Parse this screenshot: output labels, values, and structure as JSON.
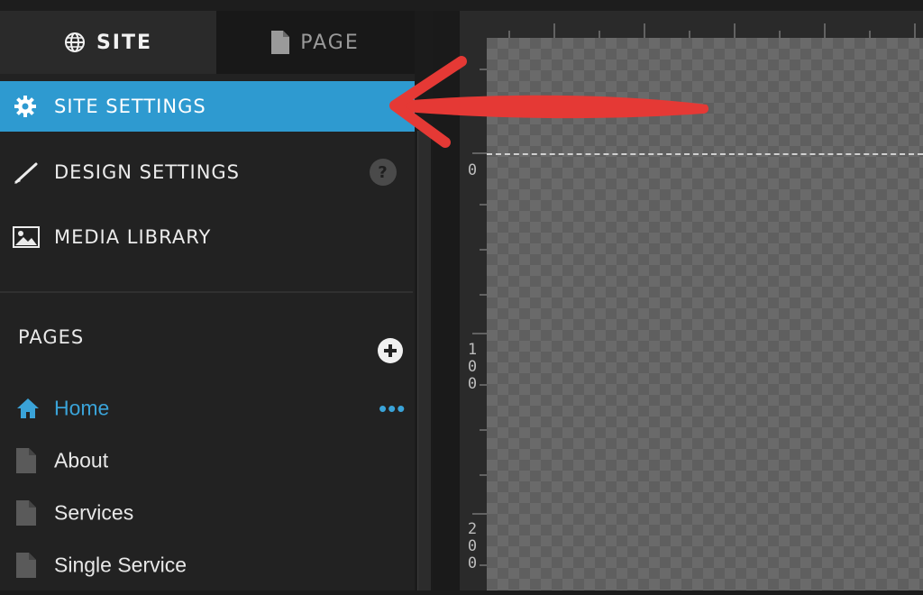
{
  "tabs": {
    "site_label": "SITE",
    "page_label": "PAGE"
  },
  "menu": {
    "site_settings": "SITE SETTINGS",
    "design_settings": "DESIGN SETTINGS",
    "media_library": "MEDIA LIBRARY",
    "help_glyph": "?"
  },
  "pages": {
    "heading": "PAGES",
    "items": [
      {
        "label": "Home",
        "icon": "home-icon",
        "active": true
      },
      {
        "label": "About",
        "icon": "page-icon"
      },
      {
        "label": "Services",
        "icon": "page-icon"
      },
      {
        "label": "Single Service",
        "icon": "page-icon"
      }
    ],
    "more_glyph": "•••"
  },
  "ruler": {
    "marks": [
      "0",
      "100",
      "200"
    ]
  },
  "colors": {
    "accent": "#2e9ad0",
    "link": "#3aa3d8",
    "arrow": "#e53935",
    "sidebar_bg": "#222222"
  }
}
